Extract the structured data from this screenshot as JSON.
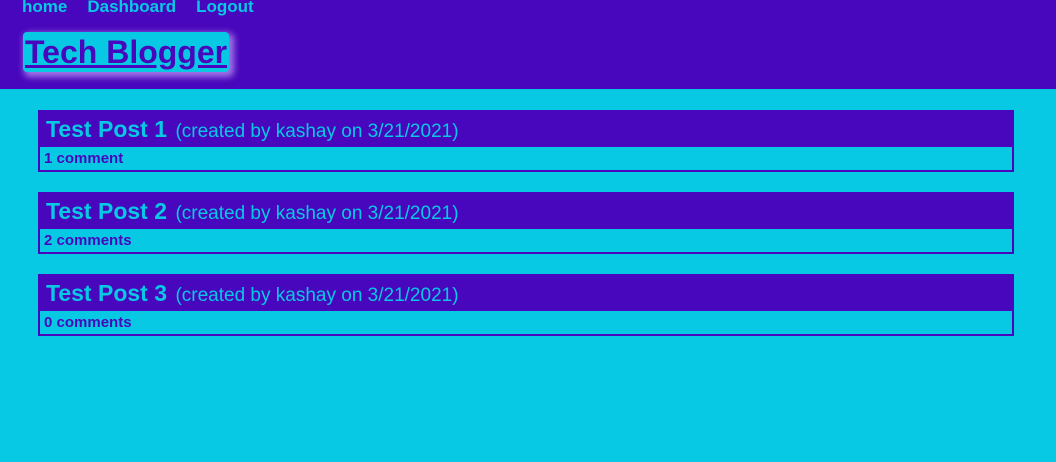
{
  "nav": {
    "items": [
      {
        "label": "home"
      },
      {
        "label": "Dashboard"
      },
      {
        "label": "Logout"
      }
    ]
  },
  "brand": {
    "title": "Tech Blogger"
  },
  "posts": [
    {
      "title": "Test Post 1",
      "meta": "(created by kashay on 3/21/2021)",
      "comments": "1 comment"
    },
    {
      "title": "Test Post 2",
      "meta": "(created by kashay on 3/21/2021)",
      "comments": "2 comments"
    },
    {
      "title": "Test Post 3",
      "meta": "(created by kashay on 3/21/2021)",
      "comments": "0 comments"
    }
  ],
  "colors": {
    "primary": "#4807bc",
    "accent": "#08c9e4"
  }
}
